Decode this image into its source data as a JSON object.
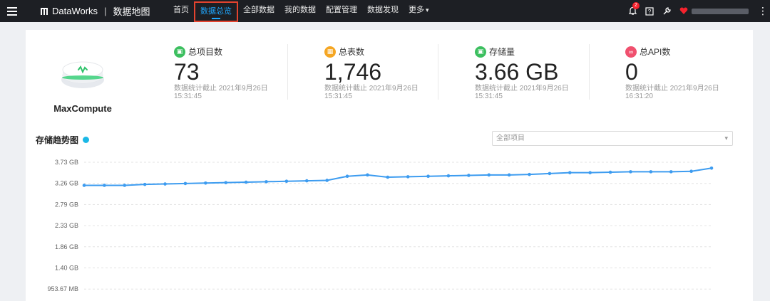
{
  "header": {
    "brand": "DataWorks",
    "separator": "|",
    "product": "数据地图",
    "nav": [
      {
        "label": "首页"
      },
      {
        "label": "数据总览"
      },
      {
        "label": "全部数据"
      },
      {
        "label": "我的数据"
      },
      {
        "label": "配置管理"
      },
      {
        "label": "数据发现"
      },
      {
        "label": "更多"
      }
    ],
    "notification_count": "2",
    "icons": [
      "menu-icon",
      "bell-icon",
      "help-icon",
      "wrench-icon",
      "user-icon",
      "more-icon"
    ]
  },
  "engine": {
    "name": "MaxCompute"
  },
  "stats": [
    {
      "title": "总项目数",
      "value": "73",
      "note": "数据统计截止 2021年9月26日 15:31:45",
      "color": "#3cbf5f"
    },
    {
      "title": "总表数",
      "value": "1,746",
      "note": "数据统计截止 2021年9月26日 15:31:45",
      "color": "#f5a623"
    },
    {
      "title": "存储量",
      "value": "3.66 GB",
      "note": "数据统计截止 2021年9月26日 15:31:45",
      "color": "#3cbf5f"
    },
    {
      "title": "总API数",
      "value": "0",
      "note": "数据统计截止 2021年9月26日 16:31:20",
      "color": "#f0506e"
    }
  ],
  "trend": {
    "title": "存储趋势图",
    "filter_value": "全部项目"
  },
  "chart_data": {
    "type": "line",
    "title": "存储趋势图",
    "yticks": [
      "3.73 GB",
      "3.26 GB",
      "2.79 GB",
      "2.33 GB",
      "1.86 GB",
      "1.40 GB",
      "953.67 MB"
    ],
    "ytick_values_gb": [
      3.73,
      3.26,
      2.79,
      2.33,
      1.86,
      1.4,
      0.93
    ],
    "series": [
      {
        "color": "#3d9cf0",
        "values": [
          3.22,
          3.22,
          3.22,
          3.24,
          3.25,
          3.26,
          3.27,
          3.28,
          3.29,
          3.3,
          3.31,
          3.32,
          3.33,
          3.42,
          3.45,
          3.4,
          3.41,
          3.42,
          3.43,
          3.44,
          3.45,
          3.45,
          3.46,
          3.48,
          3.5,
          3.5,
          3.51,
          3.52,
          3.52,
          3.52,
          3.53,
          3.6
        ]
      }
    ],
    "grid": true,
    "legend": "none"
  }
}
